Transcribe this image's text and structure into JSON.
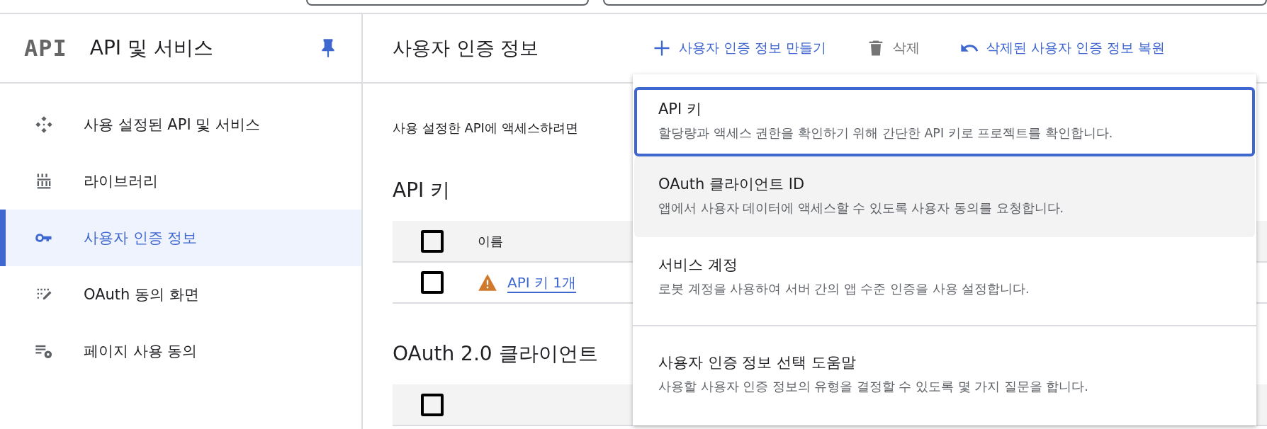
{
  "sidebar": {
    "logo": "API",
    "title": "API 및 서비스",
    "items": [
      {
        "label": "사용 설정된 API 및 서비스",
        "selected": false
      },
      {
        "label": "라이브러리",
        "selected": false
      },
      {
        "label": "사용자 인증 정보",
        "selected": true
      },
      {
        "label": "OAuth 동의 화면",
        "selected": false
      },
      {
        "label": "페이지 사용 동의",
        "selected": false
      }
    ]
  },
  "header": {
    "title": "사용자 인증 정보",
    "actions": [
      {
        "label": "사용자 인증 정보 만들기",
        "disabled": false
      },
      {
        "label": "삭제",
        "disabled": true
      },
      {
        "label": "삭제된 사용자 인증 정보 복원",
        "disabled": false
      }
    ]
  },
  "intro": "사용 설정한 API에 액세스하려면",
  "api_keys": {
    "heading": "API 키",
    "header_checked": false,
    "columns": [
      "이름"
    ],
    "rows": [
      {
        "checked": false,
        "warning": true,
        "name": "API 키 1개"
      }
    ]
  },
  "oauth": {
    "heading": "OAuth 2.0 클라이언트",
    "header_checked": false
  },
  "menu": [
    {
      "kind": "option",
      "title": "API 키",
      "description": "할당량과 액세스 권한을 확인하기 위해 간단한 API 키로 프로젝트를 확인합니다.",
      "selected": true,
      "hovered": false
    },
    {
      "kind": "option",
      "title": "OAuth 클라이언트 ID",
      "description": "앱에서 사용자 데이터에 액세스할 수 있도록 사용자 동의를 요청합니다.",
      "selected": false,
      "hovered": true
    },
    {
      "kind": "option",
      "title": "서비스 계정",
      "description": "로봇 계정을 사용하여 서버 간의 앱 수준 인증을 사용 설정합니다.",
      "selected": false,
      "hovered": false
    },
    {
      "kind": "help",
      "title": "사용자 인증 정보 선택 도움말",
      "description": "사용할 사용자 인증 정보의 유형을 결정할 수 있도록 몇 가지 질문을 합니다.",
      "selected": false,
      "hovered": false
    }
  ]
}
